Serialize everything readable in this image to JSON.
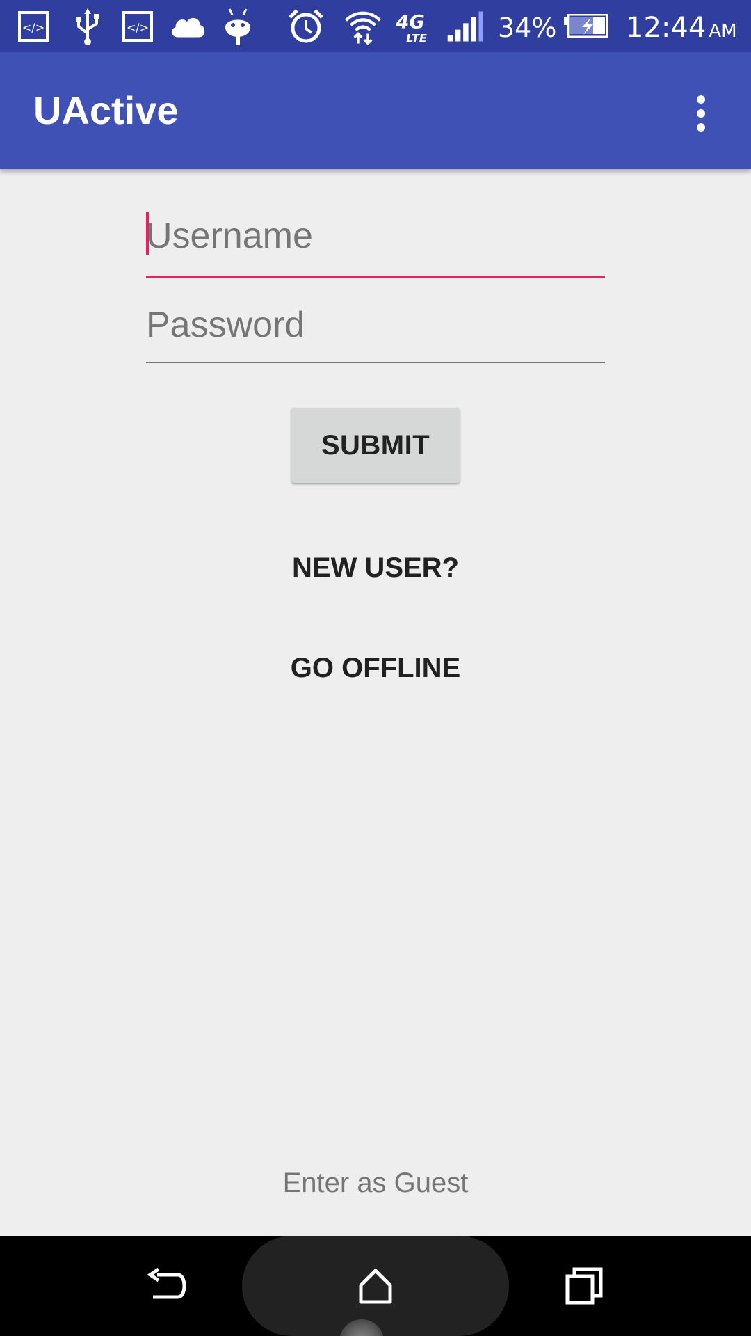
{
  "status_bar": {
    "icons": [
      "code-icon",
      "usb-icon",
      "code-icon",
      "cloud-icon",
      "android-icon",
      "alarm-icon",
      "wifi-icon",
      "lte-4g-icon",
      "signal-icon",
      "battery-charging-icon"
    ],
    "network_type": "4G",
    "network_subtype": "LTE",
    "battery_percent": "34%",
    "time": "12:44",
    "ampm": "AM",
    "background_color": "#303f9f"
  },
  "app_bar": {
    "title": "UActive",
    "menu_icon": "overflow-menu-icon",
    "background_color": "#3f51b5"
  },
  "login": {
    "username_placeholder": "Username",
    "username_value": "",
    "password_placeholder": "Password",
    "password_value": "",
    "submit_label": "SUBMIT",
    "new_user_label": "NEW USER?",
    "go_offline_label": "GO OFFLINE",
    "guest_label": "Enter as Guest",
    "accent_color": "#e91e63"
  },
  "nav_bar": {
    "icons": [
      "back-icon",
      "home-icon",
      "recents-icon"
    ]
  }
}
